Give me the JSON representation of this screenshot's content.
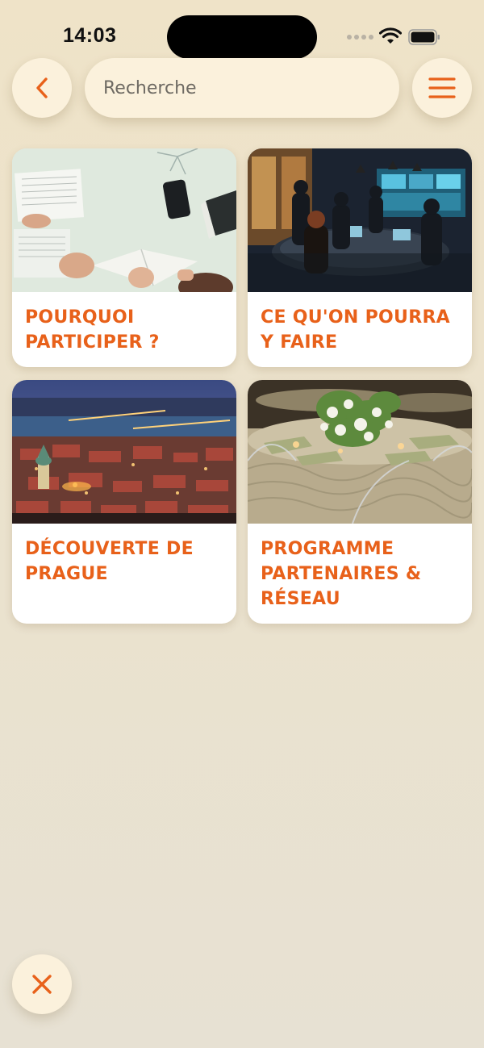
{
  "status_bar": {
    "time": "14:03"
  },
  "header": {
    "back_icon": "chevron-left-icon",
    "menu_icon": "hamburger-menu-icon",
    "search": {
      "placeholder": "Recherche",
      "value": ""
    }
  },
  "cards": [
    {
      "title": "POURQUOI\nPARTICIPER ?",
      "image": "reading-documents-photo"
    },
    {
      "title": "CE QU'ON POURRA\nY FAIRE",
      "image": "tech-meeting-room-photo"
    },
    {
      "title": "DÉCOUVERTE DE\nPRAGUE",
      "image": "prague-night-city-photo"
    },
    {
      "title": "PROGRAMME\nPARTENAIRES &\nRÉSEAU",
      "image": "banquet-table-photo"
    }
  ],
  "footer": {
    "close_icon": "close-icon"
  },
  "colors": {
    "accent": "#e8611a",
    "surface": "#fbf1dc",
    "card": "#ffffff",
    "background": "#efe3c8"
  }
}
